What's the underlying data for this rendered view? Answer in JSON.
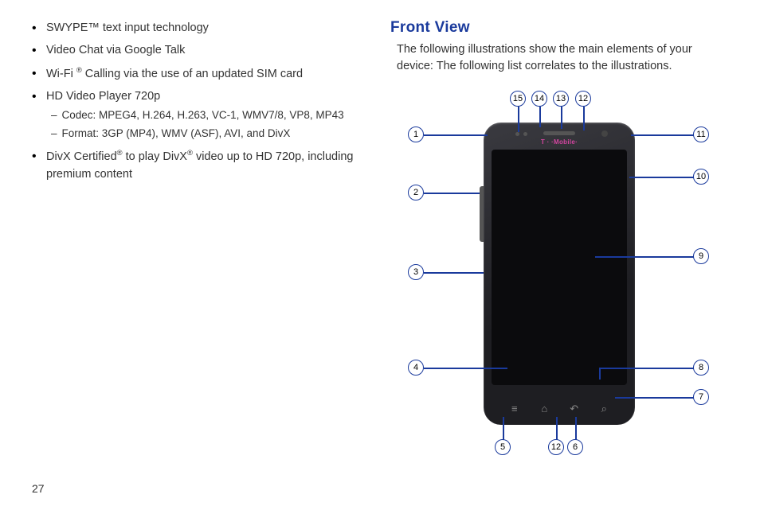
{
  "page_number": "27",
  "left": {
    "bullets": [
      {
        "text_html": "SWYPE™ text input technology"
      },
      {
        "text_html": "Video Chat via Google Talk"
      },
      {
        "pre": "Wi-Fi ",
        "sup": "®",
        "post": " Calling via the use of an updated SIM card"
      },
      {
        "text_html": "HD Video Player 720p",
        "subs": [
          "Codec: MPEG4, H.264, H.263, VC-1, WMV7/8, VP8, MP43",
          "Format: 3GP (MP4), WMV (ASF), AVI, and DivX"
        ]
      },
      {
        "pre": "DivX Certified",
        "sup": "®",
        "mid": " to play DivX",
        "sup2": "®",
        "post": "  video up to HD 720p, including premium content"
      }
    ]
  },
  "right": {
    "heading": "Front View",
    "intro": "The following illustrations show the main elements of your device: The following list correlates to the illustrations.",
    "brand": "T · ·Mobile·"
  },
  "callouts": {
    "c1": "1",
    "c2": "2",
    "c3": "3",
    "c4": "4",
    "c5": "5",
    "c6": "6",
    "c7": "7",
    "c8": "8",
    "c9": "9",
    "c10": "10",
    "c11": "11",
    "c12t": "12",
    "c12b": "12",
    "c13": "13",
    "c14": "14",
    "c15": "15"
  },
  "nav_icons": {
    "menu": "≡",
    "home": "⌂",
    "back": "↶",
    "search": "⌕"
  }
}
